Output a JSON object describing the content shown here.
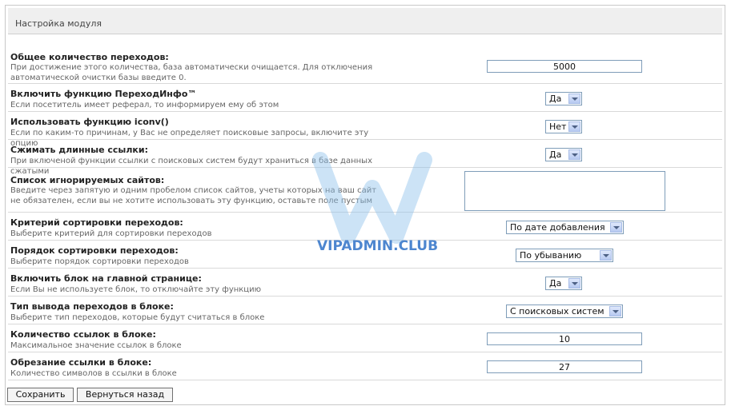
{
  "header": {
    "title": "Настройка модуля"
  },
  "settings": [
    {
      "label": "Общее количество переходов:",
      "desc": "При достижение этого количества, база автоматически очищается. Для отключения автоматической очистки базы введите 0.",
      "value": "5000"
    },
    {
      "label": "Включить функцию ПереходИнфо™",
      "desc": "Если посетитель имеет реферал, то информируем ему об этом",
      "value": "Да"
    },
    {
      "label": "Использовать функцию iconv()",
      "desc": "Если по каким-то причинам, у Вас не определяет поисковые запросы, включите эту опцию",
      "value": "Нет"
    },
    {
      "label": "Сжимать длинные ссылки:",
      "desc": "При включеной функции ссылки с поисковых систем будут храниться в базе данных сжатыми",
      "value": "Да"
    },
    {
      "label": "Список игнорируемых сайтов:",
      "desc": "Введите через запятую и одним пробелом список сайтов, учеты которых на ваш сайт не обязателен, если вы не хотите использовать эту функцию, оставьте поле пустым",
      "value": ""
    },
    {
      "label": "Критерий сортировки переходов:",
      "desc": "Выберите критерий для сортировки переходов",
      "value": "По дате добавления"
    },
    {
      "label": "Порядок сортировки переходов:",
      "desc": "Выберите порядок сортировки переходов",
      "value": "По убыванию"
    },
    {
      "label": "Включить блок на главной странице:",
      "desc": "Если Вы не используете блок, то отключайте эту функцию",
      "value": "Да"
    },
    {
      "label": "Тип вывода переходов в блоке:",
      "desc": "Выберите тип переходов, которые будут считаться в блоке",
      "value": "С поисковых систем"
    },
    {
      "label": "Количество ссылок в блоке:",
      "desc": "Максимальное значение ссылок в блоке",
      "value": "10"
    },
    {
      "label": "Обрезание ссылки в блоке:",
      "desc": "Количество символов в ссылки в блоке",
      "value": "27"
    }
  ],
  "buttons": {
    "save": "Сохранить",
    "back": "Вернуться назад"
  },
  "watermark": {
    "text": "VIPADMIN.CLUB"
  }
}
